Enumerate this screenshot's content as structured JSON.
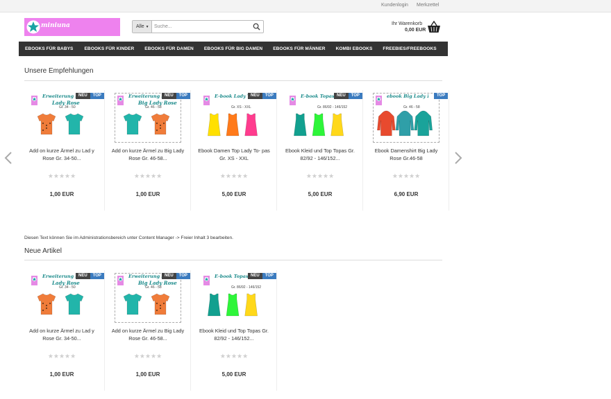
{
  "topbar": {
    "login": "Kundenlogin",
    "wishlist": "Merkzettel"
  },
  "logo": {
    "brand": "miniuna"
  },
  "search": {
    "category": "Alle",
    "placeholder": "Suche..."
  },
  "cart": {
    "label": "Ihr Warenkorb",
    "total": "0,00 EUR"
  },
  "nav": [
    "EBOOKS FÜR BABYS",
    "EBOOKS FÜR KINDER",
    "EBOOKS FÜR DAMEN",
    "EBOOKS FÜR BIG DAMEN",
    "EBOOKS FÜR MÄNNER",
    "KOMBI EBOOKS",
    "FREEBIES/FREEBOOKS"
  ],
  "sections": {
    "recommend_title": "Unsere Empfehlungen",
    "new_title": "Neue Artikel",
    "note": "Diesen Text können Sie im Administrationsbereich unter Content Manager -> Freier Inhalt 3 bearbeiten."
  },
  "badges": {
    "neu": "NEU",
    "top": "TOP"
  },
  "stars": "★★★★★",
  "recommend": [
    {
      "name": "Add on kurze Ärmel zu Lad y Rose Gr. 34-50...",
      "price": "1,00 EUR",
      "img_title": "Erweiterung kurze Ärmel",
      "img_title2": "Lady Rose",
      "img_size": "Gr. 34 - 50",
      "neu": true,
      "top": true
    },
    {
      "name": "Add on kurze Ärmel zu Big Lady Rose Gr. 46-58...",
      "price": "1,00 EUR",
      "img_title": "Erweiterung kurze Ärmel",
      "img_title2": "Big Lady Rose",
      "img_size": "Gr. 46 - 58",
      "neu": true,
      "top": true
    },
    {
      "name": "Ebook Damen Top Lady To- pas Gr. XS - XXL",
      "price": "5,00 EUR",
      "img_title": "E-book Lady Topas",
      "img_title2": "",
      "img_size": "Gr. XS - XXL",
      "neu": true,
      "top": true
    },
    {
      "name": "Ebook Kleid und Top Topas Gr. 82/92 - 146/152...",
      "price": "5,00 EUR",
      "img_title": "E-book Topas",
      "img_title2": "",
      "img_size": "Gr. 86/92 - 146/152",
      "neu": true,
      "top": true
    },
    {
      "name": "Ebook Damenshirt Big Lady Rose Gr.46-58",
      "price": "6,90 EUR",
      "img_title": "ebook Big Lady Rose",
      "img_title2": "",
      "img_size": "Gr. 46 - 58",
      "neu": false,
      "top": true
    }
  ],
  "new_items": [
    {
      "name": "Add on kurze Ärmel zu Lad y Rose Gr. 34-50...",
      "price": "1,00 EUR",
      "img_title": "Erweiterung kurze Ärmel",
      "img_title2": "Lady Rose",
      "img_size": "Gr. 34 - 50",
      "neu": true,
      "top": true
    },
    {
      "name": "Add on kurze Ärmel zu Big Lady Rose Gr. 46-58...",
      "price": "1,00 EUR",
      "img_title": "Erweiterung kurze Ärmel",
      "img_title2": "Big Lady Rose",
      "img_size": "Gr. 46 - 58",
      "neu": true,
      "top": true
    },
    {
      "name": "Ebook Kleid und Top Topas Gr. 82/92 - 146/152...",
      "price": "5,00 EUR",
      "img_title": "E-book Topas",
      "img_title2": "",
      "img_size": "Gr. 86/92 - 146/152",
      "neu": true,
      "top": true
    }
  ],
  "colors": {
    "nav_bg": "#333333",
    "badge_top": "#3b7bbf",
    "badge_neu": "#444444",
    "logo_bg": "#ee82ee"
  }
}
